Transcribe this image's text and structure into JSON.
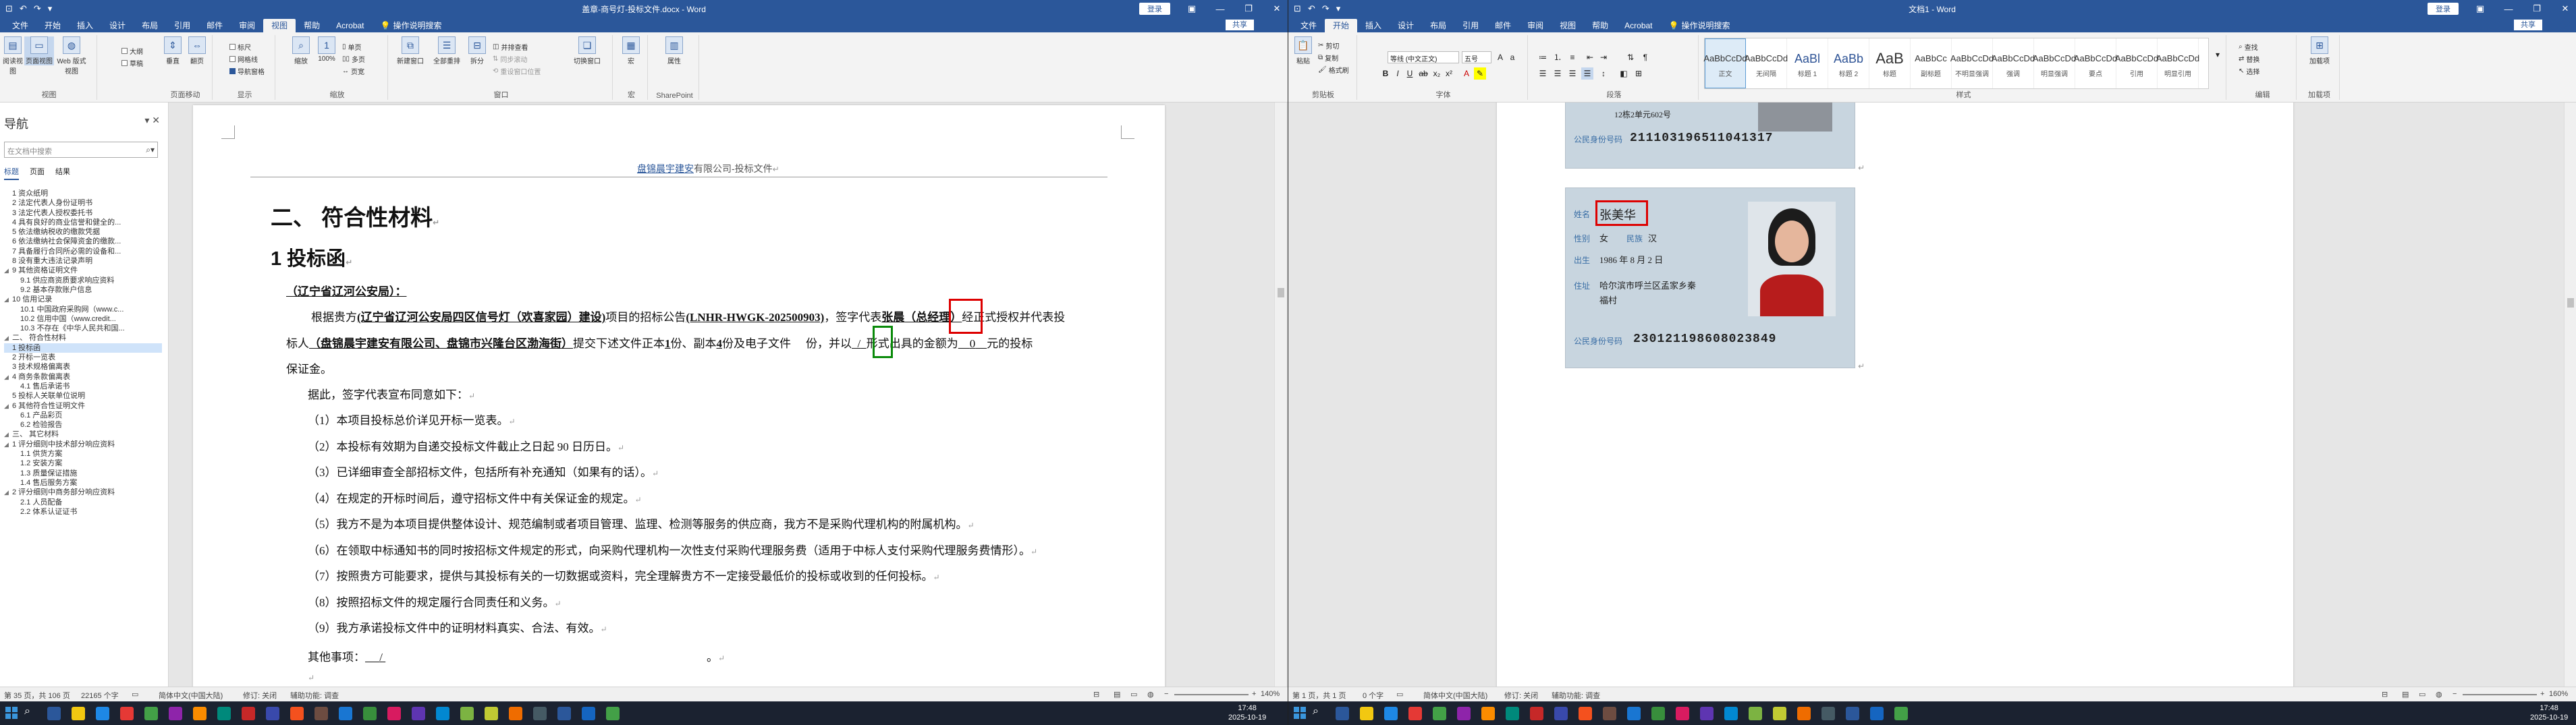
{
  "left": {
    "window_title": "盖章-商号灯-投标文件.docx - Word",
    "login_label": "登录",
    "share_label": "共享",
    "tabs": [
      "文件",
      "开始",
      "插入",
      "设计",
      "布局",
      "引用",
      "邮件",
      "审阅",
      "视图",
      "帮助",
      "Acrobat"
    ],
    "tell_me": "操作说明搜索",
    "ribbon": {
      "read_mode": "阅读视图",
      "print_layout": "页面视图",
      "web_layout": "Web 版式视图",
      "outline": "大纲",
      "draft": "草稿",
      "ruler": "标尺",
      "gridlines": "网格线",
      "nav_pane": "导航窗格",
      "vertical": "垂直",
      "side_to_side": "翻页",
      "zoom": "缩放",
      "zoom_100": "100%",
      "one_page": "单页",
      "multi_page": "多页",
      "page_width": "页宽",
      "new_window": "新建窗口",
      "arrange_all": "全部重排",
      "split": "拆分",
      "side_by_side": "并排查看",
      "sync_scroll": "同步滚动",
      "reset_pos": "重设窗口位置",
      "switch_windows": "切换窗口",
      "macros": "宏",
      "properties": "属性",
      "group_views": "视图",
      "group_page_move": "页面移动",
      "group_show": "显示",
      "group_zoom": "缩放",
      "group_window": "窗口",
      "group_macros": "宏",
      "group_sharepoint": "SharePoint"
    },
    "nav": {
      "title": "导航",
      "search_placeholder": "在文档中搜索",
      "tabs": [
        "标题",
        "页面",
        "结果"
      ],
      "items": [
        {
          "text": "1 资众纸明",
          "lvl": 0
        },
        {
          "text": "2 法定代表人身份证明书",
          "lvl": 0
        },
        {
          "text": "3 法定代表人授权委托书",
          "lvl": 0
        },
        {
          "text": "4 具有良好的商业信誉和健全的...",
          "lvl": 0
        },
        {
          "text": "5 依法缴纳税收的缴款凭据",
          "lvl": 0
        },
        {
          "text": "6 依法缴纳社会保障资金的缴款...",
          "lvl": 0
        },
        {
          "text": "7 具备履行合同所必需的设备和...",
          "lvl": 0
        },
        {
          "text": "8 没有重大违法记录声明",
          "lvl": 0
        },
        {
          "text": "9 其他资格证明文件",
          "lvl": 0,
          "tw": "◢"
        },
        {
          "text": "9.1 供应商资质要求响应资料",
          "lvl": 1
        },
        {
          "text": "9.2 基本存款账户信息",
          "lvl": 1
        },
        {
          "text": "10 信用记录",
          "lvl": 0,
          "tw": "◢"
        },
        {
          "text": "10.1 中国政府采购网（www.c...",
          "lvl": 1
        },
        {
          "text": "10.2 信用中国（www.credit...",
          "lvl": 1
        },
        {
          "text": "10.3 不存在《中华人民共和国...",
          "lvl": 1
        },
        {
          "text": "二、 符合性材料",
          "lvl": 0,
          "tw": "◢"
        },
        {
          "text": "1 投标函",
          "lvl": 0,
          "sel": true
        },
        {
          "text": "2 开标一览表",
          "lvl": 0
        },
        {
          "text": "3 技术规格偏离表",
          "lvl": 0
        },
        {
          "text": "4 商务条款偏离表",
          "lvl": 0,
          "tw": "◢"
        },
        {
          "text": "4.1 售后承诺书",
          "lvl": 1
        },
        {
          "text": "5 投标人关联单位说明",
          "lvl": 0
        },
        {
          "text": "6 其他符合性证明文件",
          "lvl": 0,
          "tw": "◢"
        },
        {
          "text": "6.1 产品彩页",
          "lvl": 1
        },
        {
          "text": "6.2 检验报告",
          "lvl": 1
        },
        {
          "text": "三、 其它材料",
          "lvl": 0,
          "tw": "◢"
        },
        {
          "text": "1 评分细则中技术部分响应资料",
          "lvl": 0,
          "tw": "◢"
        },
        {
          "text": "1.1 供货方案",
          "lvl": 1
        },
        {
          "text": "1.2 安装方案",
          "lvl": 1
        },
        {
          "text": "1.3 质量保证措施",
          "lvl": 1
        },
        {
          "text": "1.4 售后服务方案",
          "lvl": 1
        },
        {
          "text": "2 评分细则中商务部分响应资料",
          "lvl": 0,
          "tw": "◢"
        },
        {
          "text": "2.1 人员配备",
          "lvl": 1
        },
        {
          "text": "2.2 体系认证证书",
          "lvl": 1
        }
      ]
    },
    "doc": {
      "header": {
        "a": "盘锦晨宇建安",
        "b": "有限公司-投标文件"
      },
      "section_title": "二、 符合性材料",
      "sub_title": "1   投标函",
      "addressee": "（辽宁省辽河公安局）：",
      "p1_a": "根据贵方",
      "p1_project": "(辽宁省辽河公安局四区信号灯（欢喜家园）建设)",
      "p1_b": "项目的招标公告",
      "p1_no": "(LNHR-HWGK-202500903)",
      "p1_c": "，签字代表",
      "p1_rep": "张晨",
      "p1_title": "（总经理）",
      "p1_d": "经正式授权并代表投",
      "p2_a": "标人",
      "p2_bidder": "（盘锦晨宇建安有限公司、盘锦市兴隆台区渤海街）",
      "p2_b": "提交下述文件正本",
      "p2_n1": "1",
      "p2_c": "份、副本",
      "p2_n2": "4",
      "p2_d": "份及电子文件",
      "p2_e": "份，并以",
      "p2_f": "/",
      "p2_g": "形式出具的金额为",
      "p2_amount": "0",
      "p2_h": "元的投标",
      "p3": "保证金。",
      "declare": "据此，签字代表宣布同意如下：",
      "items": [
        "（1）本项目投标总价详见开标一览表。",
        "（2）本投标有效期为自递交投标文件截止之日起  90  日历日。",
        "（3）已详细审查全部招标文件，包括所有补充通知（如果有的话）。",
        "（4）在规定的开标时间后，遵守招标文件中有关保证金的规定。",
        "（5）我方不是为本项目提供整体设计、规范编制或者项目管理、监理、检测等服务的供应商，我方不是采购代理机构的附属机构。",
        "（6）在领取中标通知书的同时按招标文件规定的形式，向采购代理机构一次性支付采购代理服务费（适用于中标人支付采购代理服务费情形）。",
        "（7）按照贵方可能要求，提供与其投标有关的一切数据或资料，完全理解贵方不一定接受最低价的投标或收到的任何投标。",
        "（8）按照招标文件的规定履行合同责任和义务。",
        "（9）我方承诺投标文件中的证明材料真实、合法、有效。"
      ],
      "other": "其他事项：",
      "other_val": "/"
    },
    "status": {
      "page": "第 35 页，共 106 页",
      "words": "22165 个字",
      "lang": "简体中文(中国大陆)",
      "track": "修订: 关闭",
      "a11y": "辅助功能: 调查",
      "zoom": "140%"
    }
  },
  "right": {
    "window_title": "文档1 - Word",
    "login_label": "登录",
    "share_label": "共享",
    "tabs": [
      "文件",
      "开始",
      "插入",
      "设计",
      "布局",
      "引用",
      "邮件",
      "审阅",
      "视图",
      "帮助",
      "Acrobat"
    ],
    "tell_me": "操作说明搜索",
    "ribbon": {
      "paste": "粘贴",
      "cut": "剪切",
      "copy": "复制",
      "format_painter": "格式刷",
      "font_name": "等线 (中文正文)",
      "font_size": "五号",
      "group_clipboard": "剪贴板",
      "group_font": "字体",
      "group_paragraph": "段落",
      "group_styles": "样式",
      "group_editing": "编辑",
      "group_addins": "加载项",
      "find": "查找",
      "replace": "替换",
      "select": "选择",
      "addins": "加载项",
      "styles": [
        {
          "preview": "AaBbCcDd",
          "name": "正文"
        },
        {
          "preview": "AaBbCcDd",
          "name": "无间隔"
        },
        {
          "preview": "AaBl",
          "name": "标题 1"
        },
        {
          "preview": "AaBb",
          "name": "标题 2"
        },
        {
          "preview": "AaB",
          "name": "标题"
        },
        {
          "preview": "AaBbCc",
          "name": "副标题"
        },
        {
          "preview": "AaBbCcDd",
          "name": "不明显强调"
        },
        {
          "preview": "AaBbCcDd",
          "name": "强调"
        },
        {
          "preview": "AaBbCcDd",
          "name": "明显强调"
        },
        {
          "preview": "AaBbCcDd",
          "name": "要点"
        },
        {
          "preview": "AaBbCcDd",
          "name": "引用"
        },
        {
          "preview": "AaBbCcDd",
          "name": "明显引用"
        }
      ]
    },
    "cards": {
      "top_addr": "12栋2单元602号",
      "top_id_label": "公民身份号码",
      "top_id": "211103196511041317",
      "name_label": "姓名",
      "name": "张美华",
      "sex_label": "性别",
      "sex": "女",
      "eth_label": "民族",
      "eth": "汉",
      "birth_label": "出生",
      "birth": "1986 年 8 月 2 日",
      "addr_label": "住址",
      "addr1": "哈尔滨市呼兰区孟家乡秦",
      "addr2": "福村",
      "id_label": "公民身份号码",
      "id": "230121198608023849"
    },
    "status": {
      "page": "第 1 页，共 1 页",
      "words": "0 个字",
      "lang": "简体中文(中国大陆)",
      "track": "修订: 关闭",
      "a11y": "辅助功能: 调查",
      "zoom": "160%"
    }
  },
  "taskbar": {
    "time": "17:48",
    "date": "2025-10-19"
  },
  "colors": {
    "word_blue": "#2b579a",
    "mark_red": "#dd0000",
    "mark_green": "#0a8a0a"
  }
}
